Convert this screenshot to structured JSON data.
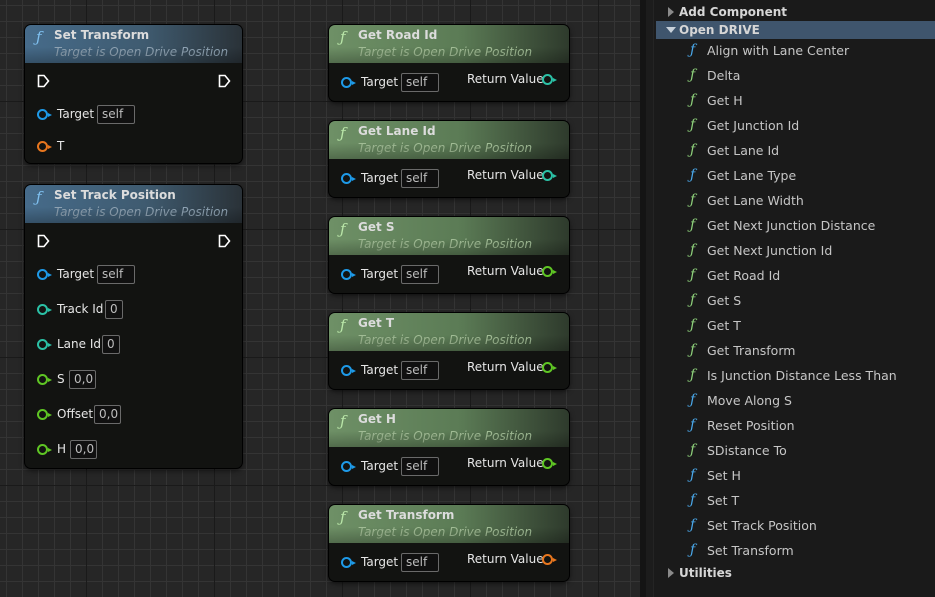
{
  "graph": {
    "nodes": [
      {
        "id": "set-transform",
        "title": "Set Transform",
        "subtitle": "Target is Open Drive Position",
        "style": "impure",
        "exec": true,
        "inputs": [
          {
            "label": "Target",
            "type": "object",
            "value": "self"
          },
          {
            "label": "T",
            "type": "struct",
            "value": null
          }
        ]
      },
      {
        "id": "set-track-position",
        "title": "Set Track Position",
        "subtitle": "Target is Open Drive Position",
        "style": "impure",
        "exec": true,
        "inputs": [
          {
            "label": "Target",
            "type": "object",
            "value": "self"
          },
          {
            "label": "Track Id",
            "type": "int",
            "value": "0"
          },
          {
            "label": "Lane Id",
            "type": "int",
            "value": "0"
          },
          {
            "label": "S",
            "type": "float",
            "value": "0,0"
          },
          {
            "label": "Offset",
            "type": "float",
            "value": "0,0"
          },
          {
            "label": "H",
            "type": "float",
            "value": "0,0"
          }
        ]
      },
      {
        "id": "get-road-id",
        "title": "Get Road Id",
        "subtitle": "Target is Open Drive Position",
        "style": "pure",
        "target_label": "Target",
        "target_value": "self",
        "return_label": "Return Value",
        "return_type": "int"
      },
      {
        "id": "get-lane-id",
        "title": "Get Lane Id",
        "subtitle": "Target is Open Drive Position",
        "style": "pure",
        "target_label": "Target",
        "target_value": "self",
        "return_label": "Return Value",
        "return_type": "int"
      },
      {
        "id": "get-s",
        "title": "Get S",
        "subtitle": "Target is Open Drive Position",
        "style": "pure",
        "target_label": "Target",
        "target_value": "self",
        "return_label": "Return Value",
        "return_type": "float"
      },
      {
        "id": "get-t",
        "title": "Get T",
        "subtitle": "Target is Open Drive Position",
        "style": "pure",
        "target_label": "Target",
        "target_value": "self",
        "return_label": "Return Value",
        "return_type": "float"
      },
      {
        "id": "get-h",
        "title": "Get H",
        "subtitle": "Target is Open Drive Position",
        "style": "pure",
        "target_label": "Target",
        "target_value": "self",
        "return_label": "Return Value",
        "return_type": "float"
      },
      {
        "id": "get-transform",
        "title": "Get Transform",
        "subtitle": "Target is Open Drive Position",
        "style": "pure",
        "target_label": "Target",
        "target_value": "self",
        "return_label": "Return Value",
        "return_type": "struct"
      }
    ],
    "pin_colors": {
      "object": "#1e9ae8",
      "int": "#2bc1a6",
      "float": "#5fc624",
      "struct": "#e8761e",
      "exec": "#ffffff"
    }
  },
  "palette": {
    "categories": [
      {
        "label": "Add Component",
        "expanded": false
      },
      {
        "label": "Open DRIVE",
        "expanded": true,
        "selected": true
      },
      {
        "label": "Utilities",
        "expanded": false
      }
    ],
    "functions": [
      {
        "label": "Align with Lane Center",
        "kind": "impure"
      },
      {
        "label": "Delta",
        "kind": "pure"
      },
      {
        "label": "Get H",
        "kind": "pure"
      },
      {
        "label": "Get Junction Id",
        "kind": "pure"
      },
      {
        "label": "Get Lane Id",
        "kind": "pure"
      },
      {
        "label": "Get Lane Type",
        "kind": "impure"
      },
      {
        "label": "Get Lane Width",
        "kind": "pure"
      },
      {
        "label": "Get Next Junction Distance",
        "kind": "pure"
      },
      {
        "label": "Get Next Junction Id",
        "kind": "pure"
      },
      {
        "label": "Get Road Id",
        "kind": "pure"
      },
      {
        "label": "Get S",
        "kind": "pure"
      },
      {
        "label": "Get T",
        "kind": "pure"
      },
      {
        "label": "Get Transform",
        "kind": "pure"
      },
      {
        "label": "Is Junction Distance Less Than",
        "kind": "pure"
      },
      {
        "label": "Move Along S",
        "kind": "impure"
      },
      {
        "label": "Reset Position",
        "kind": "impure"
      },
      {
        "label": "SDistance To",
        "kind": "pure"
      },
      {
        "label": "Set H",
        "kind": "impure"
      },
      {
        "label": "Set T",
        "kind": "impure"
      },
      {
        "label": "Set Track Position",
        "kind": "impure"
      },
      {
        "label": "Set Transform",
        "kind": "impure"
      }
    ],
    "function_icon": "f-function-icon",
    "colors": {
      "pure": "#8ed17b",
      "impure": "#4aa8ea",
      "selected_bg": "#3f556d"
    }
  }
}
